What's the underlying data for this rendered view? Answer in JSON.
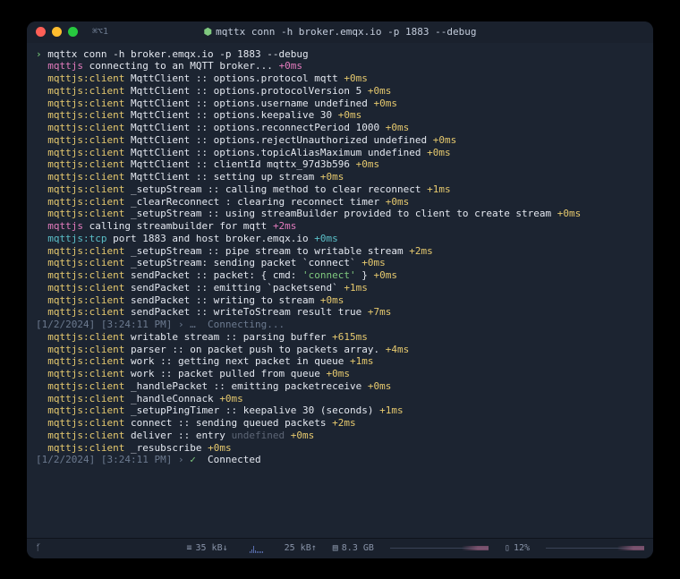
{
  "titlebar": {
    "tab_label": "⌘⌥1",
    "title": "mqttx conn -h broker.emqx.io -p 1883 --debug"
  },
  "prompt": {
    "symbol": "›",
    "command": "mqttx conn -h broker.emqx.io -p 1883 --debug"
  },
  "log_lines": [
    {
      "pre": "mqttjs",
      "body": "connecting to an MQTT broker...",
      "suf": "+0ms",
      "pre_cls": "pink"
    },
    {
      "pre": "mqttjs:client",
      "body": "MqttClient :: options.protocol mqtt",
      "suf": "+0ms",
      "pre_cls": "yellow"
    },
    {
      "pre": "mqttjs:client",
      "body": "MqttClient :: options.protocolVersion 5",
      "suf": "+0ms",
      "pre_cls": "yellow"
    },
    {
      "pre": "mqttjs:client",
      "body": "MqttClient :: options.username undefined",
      "suf": "+0ms",
      "pre_cls": "yellow"
    },
    {
      "pre": "mqttjs:client",
      "body": "MqttClient :: options.keepalive 30",
      "suf": "+0ms",
      "pre_cls": "yellow"
    },
    {
      "pre": "mqttjs:client",
      "body": "MqttClient :: options.reconnectPeriod 1000",
      "suf": "+0ms",
      "pre_cls": "yellow"
    },
    {
      "pre": "mqttjs:client",
      "body": "MqttClient :: options.rejectUnauthorized undefined",
      "suf": "+0ms",
      "pre_cls": "yellow"
    },
    {
      "pre": "mqttjs:client",
      "body": "MqttClient :: options.topicAliasMaximum undefined",
      "suf": "+0ms",
      "pre_cls": "yellow"
    },
    {
      "pre": "mqttjs:client",
      "body": "MqttClient :: clientId mqttx_97d3b596",
      "suf": "+0ms",
      "pre_cls": "yellow"
    },
    {
      "pre": "mqttjs:client",
      "body": "MqttClient :: setting up stream",
      "suf": "+0ms",
      "pre_cls": "yellow"
    },
    {
      "pre": "mqttjs:client",
      "body": "_setupStream :: calling method to clear reconnect",
      "suf": "+1ms",
      "pre_cls": "yellow"
    },
    {
      "pre": "mqttjs:client",
      "body": "_clearReconnect : clearing reconnect timer",
      "suf": "+0ms",
      "pre_cls": "yellow"
    },
    {
      "pre": "mqttjs:client",
      "body": "_setupStream :: using streamBuilder provided to client to create stream",
      "suf": "+0ms",
      "pre_cls": "yellow"
    },
    {
      "pre": "mqttjs",
      "body": "calling streambuilder for mqtt",
      "suf": "+2ms",
      "pre_cls": "pink"
    },
    {
      "pre": "mqttjs:tcp",
      "body": "port 1883 and host broker.emqx.io",
      "suf": "+0ms",
      "pre_cls": "cyan"
    },
    {
      "pre": "mqttjs:client",
      "body": "_setupStream :: pipe stream to writable stream",
      "suf": "+2ms",
      "pre_cls": "yellow"
    },
    {
      "pre": "mqttjs:client",
      "body": "_setupStream: sending packet `connect`",
      "suf": "+0ms",
      "pre_cls": "yellow"
    },
    {
      "pre": "mqttjs:client",
      "body": "sendPacket :: packet: { cmd: ",
      "quoted": "'connect'",
      "body2": " }",
      "suf": "+0ms",
      "pre_cls": "yellow"
    },
    {
      "pre": "mqttjs:client",
      "body": "sendPacket :: emitting `packetsend`",
      "suf": "+1ms",
      "pre_cls": "yellow"
    },
    {
      "pre": "mqttjs:client",
      "body": "sendPacket :: writing to stream",
      "suf": "+0ms",
      "pre_cls": "yellow"
    },
    {
      "pre": "mqttjs:client",
      "body": "sendPacket :: writeToStream result true",
      "suf": "+7ms",
      "pre_cls": "yellow"
    }
  ],
  "status_connecting": {
    "ts": "[1/2/2024] [3:24:11 PM] › …  Connecting..."
  },
  "log_lines2": [
    {
      "pre": "mqttjs:client",
      "body": "writable stream :: parsing buffer",
      "suf": "+615ms",
      "pre_cls": "yellow"
    },
    {
      "pre": "mqttjs:client",
      "body": "parser :: on packet push to packets array.",
      "suf": "+4ms",
      "pre_cls": "yellow"
    },
    {
      "pre": "mqttjs:client",
      "body": "work :: getting next packet in queue",
      "suf": "+1ms",
      "pre_cls": "yellow"
    },
    {
      "pre": "mqttjs:client",
      "body": "work :: packet pulled from queue",
      "suf": "+0ms",
      "pre_cls": "yellow"
    },
    {
      "pre": "mqttjs:client",
      "body": "_handlePacket :: emitting packetreceive",
      "suf": "+0ms",
      "pre_cls": "yellow"
    },
    {
      "pre": "mqttjs:client",
      "body": "_handleConnack",
      "suf": "+0ms",
      "pre_cls": "yellow"
    },
    {
      "pre": "mqttjs:client",
      "body": "_setupPingTimer :: keepalive 30 (seconds)",
      "suf": "+1ms",
      "pre_cls": "yellow"
    },
    {
      "pre": "mqttjs:client",
      "body": "connect :: sending queued packets",
      "suf": "+2ms",
      "pre_cls": "yellow"
    },
    {
      "pre": "mqttjs:client",
      "body": "deliver :: entry ",
      "dim": "undefined",
      "suf": "+0ms",
      "pre_cls": "yellow"
    },
    {
      "pre": "mqttjs:client",
      "body": "_resubscribe",
      "suf": "+0ms",
      "pre_cls": "yellow"
    }
  ],
  "status_connected": {
    "ts_prefix": "[1/2/2024] [3:24:11 PM] › ",
    "check": "✓",
    "label": "  Connected"
  },
  "statusbar": {
    "branch": "ᚶ",
    "net_down": "35 kB↓",
    "net_up": "25 kB↑",
    "mem": "8.3 GB",
    "battery": "12%"
  }
}
